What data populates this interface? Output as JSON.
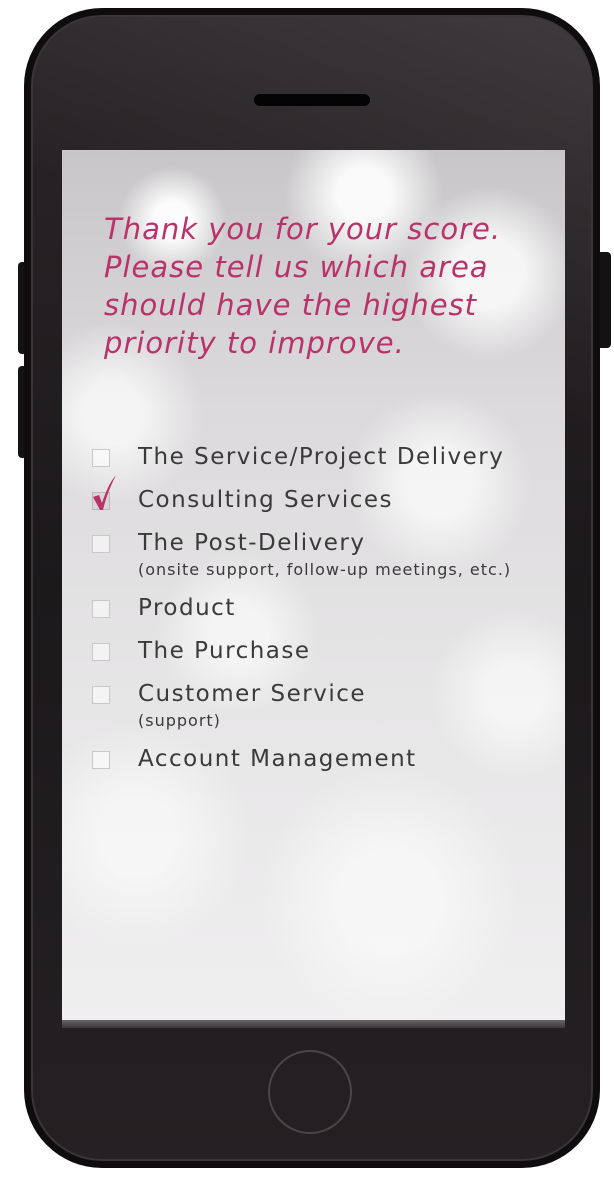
{
  "survey": {
    "question": "Thank you for your score. Please tell us which area should have the highest priority to improve.",
    "accent_color": "#b8336a",
    "options": [
      {
        "label": "The Service/Project Delivery",
        "sublabel": "",
        "checked": false
      },
      {
        "label": "Consulting Services",
        "sublabel": "",
        "checked": true
      },
      {
        "label": "The Post-Delivery",
        "sublabel": "(onsite support, follow-up meetings, etc.)",
        "checked": false
      },
      {
        "label": "Product",
        "sublabel": "",
        "checked": false
      },
      {
        "label": "The Purchase",
        "sublabel": "",
        "checked": false
      },
      {
        "label": "Customer Service",
        "sublabel": "(support)",
        "checked": false
      },
      {
        "label": "Account Management",
        "sublabel": "",
        "checked": false
      }
    ]
  },
  "device": {
    "icons": [
      "speaker-grille",
      "home-button",
      "volume-button",
      "power-button",
      "checkmark-icon"
    ]
  }
}
